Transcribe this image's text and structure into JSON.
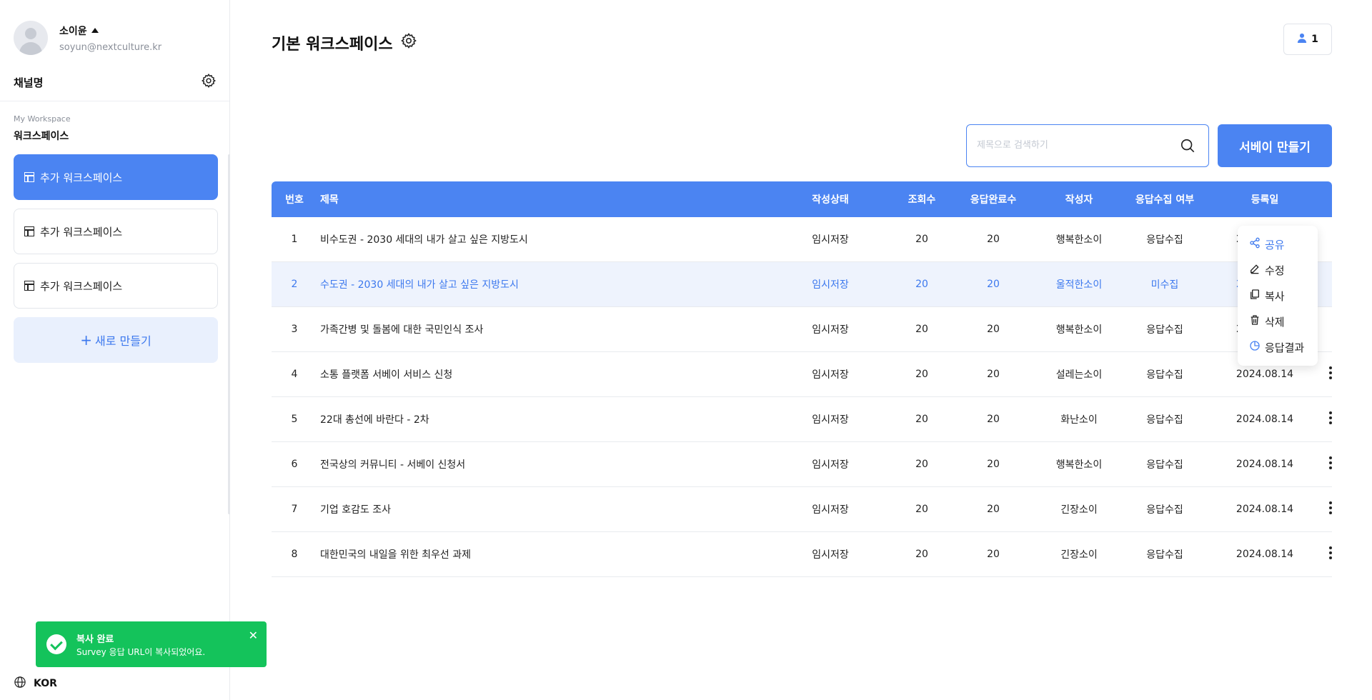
{
  "user": {
    "name": "소이윤",
    "email": "soyun@nextculture.kr"
  },
  "channel": {
    "name": "채널명"
  },
  "workspace": {
    "caption": "My Workspace",
    "title": "워크스페이스",
    "items": [
      {
        "label": "추가 워크스페이스"
      },
      {
        "label": "추가 워크스페이스"
      },
      {
        "label": "추가 워크스페이스"
      }
    ],
    "new_label": "새로 만들기"
  },
  "toast": {
    "title": "복사 완료",
    "message": "Survey 응답 URL이 복사되었어요."
  },
  "lang": {
    "label": "KOR"
  },
  "page": {
    "title": "기본 워크스페이스",
    "member_count": "1"
  },
  "search": {
    "placeholder": "제목으로 검색하기"
  },
  "create_button": "서베이 만들기",
  "table": {
    "headers": [
      "번호",
      "제목",
      "작성상태",
      "조회수",
      "응답완료수",
      "작성자",
      "응답수집 여부",
      "등록일"
    ],
    "rows": [
      [
        "1",
        "비수도권 - 2030 세대의 내가 살고 싶은 지방도시",
        "임시저장",
        "20",
        "20",
        "행복한소이",
        "응답수집",
        "2024.08.14"
      ],
      [
        "2",
        "수도권 - 2030 세대의 내가 살고 싶은 지방도시",
        "임시저장",
        "20",
        "20",
        "울적한소이",
        "미수집",
        "2024.08.14"
      ],
      [
        "3",
        "가족간병 및 돌봄에 대한 국민인식 조사",
        "임시저장",
        "20",
        "20",
        "행복한소이",
        "응답수집",
        "2024.08.14"
      ],
      [
        "4",
        "소통 플랫폼 서베이 서비스 신청",
        "임시저장",
        "20",
        "20",
        "설레는소이",
        "응답수집",
        "2024.08.14"
      ],
      [
        "5",
        "22대 총선에 바란다 - 2차",
        "임시저장",
        "20",
        "20",
        "화난소이",
        "응답수집",
        "2024.08.14"
      ],
      [
        "6",
        "전국상의 커뮤니티 - 서베이 신청서",
        "임시저장",
        "20",
        "20",
        "행복한소이",
        "응답수집",
        "2024.08.14"
      ],
      [
        "7",
        "기업 호감도 조사",
        "임시저장",
        "20",
        "20",
        "긴장소이",
        "응답수집",
        "2024.08.14"
      ],
      [
        "8",
        "대한민국의 내일을 위한 최우선 과제",
        "임시저장",
        "20",
        "20",
        "긴장소이",
        "응답수집",
        "2024.08.14"
      ]
    ]
  },
  "context_menu": {
    "items": [
      {
        "label": "공유",
        "icon": "share-icon"
      },
      {
        "label": "수정",
        "icon": "pencil-icon"
      },
      {
        "label": "복사",
        "icon": "copy-icon"
      },
      {
        "label": "삭제",
        "icon": "trash-icon"
      },
      {
        "label": "응답결과",
        "icon": "pie-chart-icon"
      }
    ]
  },
  "colors": {
    "primary": "#4b84f2",
    "success": "#14c35b",
    "highlight_row": "#eef3fd"
  }
}
